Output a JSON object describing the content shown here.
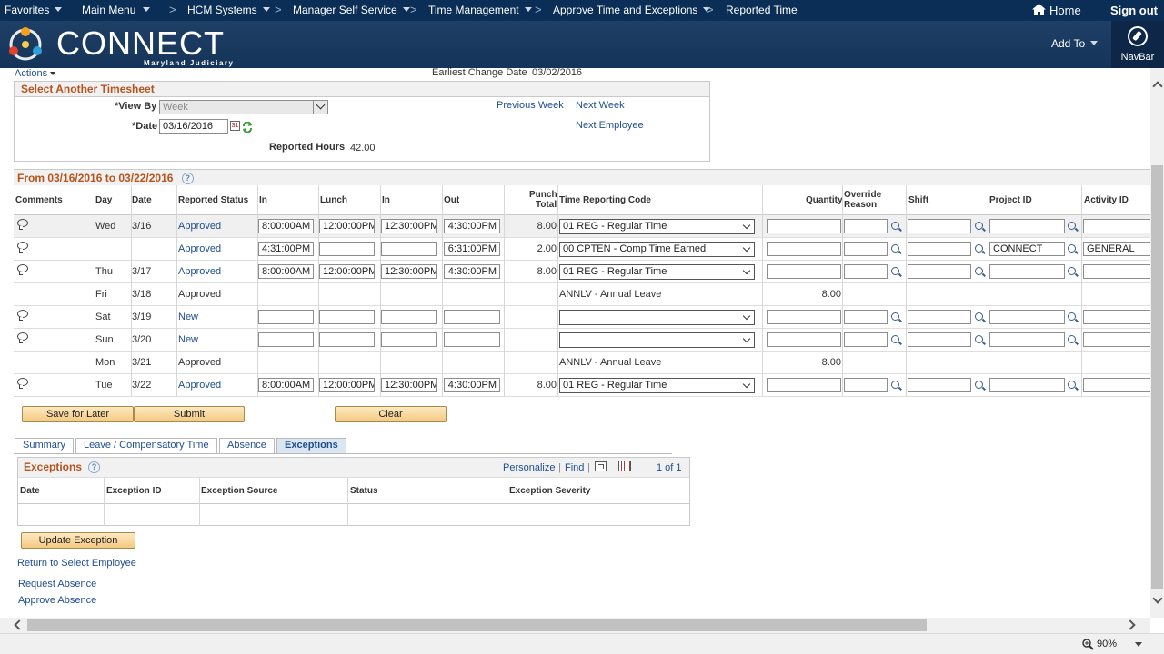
{
  "topnav": {
    "favorites": "Favorites",
    "main_menu": "Main Menu",
    "breadcrumbs": [
      "HCM Systems",
      "Manager Self Service",
      "Time Management",
      "Approve Time and Exceptions",
      "Reported Time"
    ],
    "sep": ">",
    "home": "Home",
    "signout": "Sign out"
  },
  "banner": {
    "logo": "CONNECT",
    "sub": "Maryland Judiciary",
    "add_to": "Add To",
    "navbar": "NavBar"
  },
  "actions": "Actions",
  "earliest_label": "Earliest Change Date",
  "earliest_value": "03/02/2016",
  "select": {
    "title": "Select Another Timesheet",
    "view_by_label": "*View By",
    "view_by_value": "Week",
    "date_label": "*Date",
    "date_value": "03/16/2016",
    "cal_icon_text": "31",
    "prev_week": "Previous Week",
    "next_week": "Next Week",
    "next_employee": "Next Employee",
    "reported_hours_label": "Reported Hours",
    "reported_hours_value": "42.00"
  },
  "grid": {
    "title": "From 03/16/2016 to 03/22/2016",
    "help": "?",
    "headers": {
      "comments": "Comments",
      "day": "Day",
      "date": "Date",
      "status": "Reported Status",
      "in1": "In",
      "lunch": "Lunch",
      "in2": "In",
      "out": "Out",
      "punch1": "Punch",
      "punch2": "Total",
      "trc": "Time Reporting Code",
      "quantity": "Quantity",
      "override1": "Override",
      "override2": "Reason",
      "shift": "Shift",
      "project": "Project ID",
      "activity": "Activity ID"
    },
    "rows": [
      {
        "comment": true,
        "day": "Wed",
        "date": "3/16",
        "status": "Approved",
        "in1": "8:00:00AM",
        "lunch": "12:00:00PM",
        "in2": "12:30:00PM",
        "out": "4:30:00PM",
        "total": "8.00",
        "trc": "01 REG - Regular Time",
        "trc_select": true,
        "quantity": "",
        "project": "",
        "activity": "",
        "inputs": true
      },
      {
        "comment": true,
        "day": "",
        "date": "",
        "status": "Approved",
        "in1": "4:31:00PM",
        "lunch": "",
        "in2": "",
        "out": "6:31:00PM",
        "total": "2.00",
        "trc": "00 CPTEN - Comp Time Earned",
        "trc_select": true,
        "quantity": "",
        "project": "CONNECT",
        "activity": "GENERAL",
        "inputs": true
      },
      {
        "comment": true,
        "day": "Thu",
        "date": "3/17",
        "status": "Approved",
        "in1": "8:00:00AM",
        "lunch": "12:00:00PM",
        "in2": "12:30:00PM",
        "out": "4:30:00PM",
        "total": "8.00",
        "trc": "01 REG - Regular Time",
        "trc_select": true,
        "quantity": "",
        "project": "",
        "activity": "",
        "inputs": true
      },
      {
        "comment": false,
        "day": "Fri",
        "date": "3/18",
        "status": "Approved",
        "in1": "",
        "lunch": "",
        "in2": "",
        "out": "",
        "total": "",
        "trc": "ANNLV - Annual Leave",
        "trc_select": false,
        "quantity": "8.00",
        "project": "",
        "activity": "",
        "inputs": false
      },
      {
        "comment": true,
        "day": "Sat",
        "date": "3/19",
        "status": "New",
        "in1": "",
        "lunch": "",
        "in2": "",
        "out": "",
        "total": "",
        "trc": "",
        "trc_select": true,
        "quantity": "",
        "project": "",
        "activity": "",
        "inputs": true
      },
      {
        "comment": true,
        "day": "Sun",
        "date": "3/20",
        "status": "New",
        "in1": "",
        "lunch": "",
        "in2": "",
        "out": "",
        "total": "",
        "trc": "",
        "trc_select": true,
        "quantity": "",
        "project": "",
        "activity": "",
        "inputs": true
      },
      {
        "comment": false,
        "day": "Mon",
        "date": "3/21",
        "status": "Approved",
        "in1": "",
        "lunch": "",
        "in2": "",
        "out": "",
        "total": "",
        "trc": "ANNLV - Annual Leave",
        "trc_select": false,
        "quantity": "8.00",
        "project": "",
        "activity": "",
        "inputs": false
      },
      {
        "comment": true,
        "day": "Tue",
        "date": "3/22",
        "status": "Approved",
        "in1": "8:00:00AM",
        "lunch": "12:00:00PM",
        "in2": "12:30:00PM",
        "out": "4:30:00PM",
        "total": "8.00",
        "trc": "01 REG - Regular Time",
        "trc_select": true,
        "quantity": "",
        "project": "",
        "activity": "",
        "inputs": true
      }
    ]
  },
  "buttons": {
    "save": "Save for Later",
    "submit": "Submit",
    "clear": "Clear",
    "update_exception": "Update Exception"
  },
  "tabs": [
    "Summary",
    "Leave / Compensatory Time",
    "Absence",
    "Exceptions"
  ],
  "exceptions": {
    "title": "Exceptions",
    "personalize": "Personalize",
    "find": "Find",
    "separator": "|",
    "count": "1 of 1",
    "cols": [
      "Date",
      "Exception ID",
      "Exception Source",
      "Status",
      "Exception Severity"
    ]
  },
  "links": {
    "return": "Return to Select Employee",
    "request_absence": "Request Absence",
    "approve_absence": "Approve Absence"
  },
  "zoom": "90%",
  "colors": {
    "nav": "#0b2e57",
    "section_title": "#b5541c",
    "link": "#1f4e8f",
    "button": "#f4c982"
  }
}
